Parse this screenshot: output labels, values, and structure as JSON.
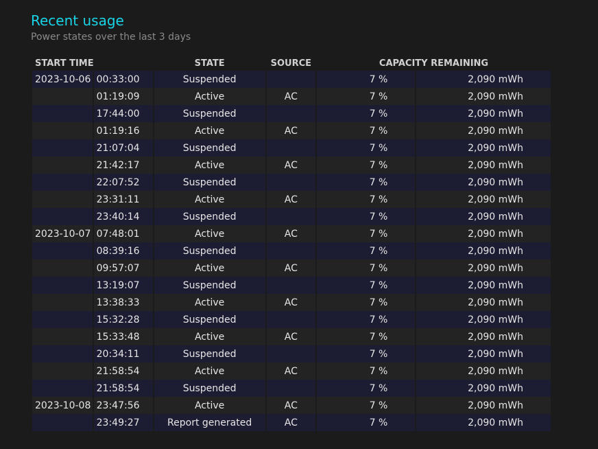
{
  "header": {
    "title": "Recent usage",
    "subtitle": "Power states over the last 3 days"
  },
  "columns": {
    "start_time": "START TIME",
    "state": "STATE",
    "source": "SOURCE",
    "capacity": "CAPACITY REMAINING"
  },
  "rows": [
    {
      "date": "2023-10-06",
      "time": "00:33:00",
      "state": "Suspended",
      "source": "",
      "percent": "7 %",
      "capacity": "2,090 mWh"
    },
    {
      "date": "",
      "time": "01:19:09",
      "state": "Active",
      "source": "AC",
      "percent": "7 %",
      "capacity": "2,090 mWh"
    },
    {
      "date": "",
      "time": "17:44:00",
      "state": "Suspended",
      "source": "",
      "percent": "7 %",
      "capacity": "2,090 mWh"
    },
    {
      "date": "",
      "time": "01:19:16",
      "state": "Active",
      "source": "AC",
      "percent": "7 %",
      "capacity": "2,090 mWh"
    },
    {
      "date": "",
      "time": "21:07:04",
      "state": "Suspended",
      "source": "",
      "percent": "7 %",
      "capacity": "2,090 mWh"
    },
    {
      "date": "",
      "time": "21:42:17",
      "state": "Active",
      "source": "AC",
      "percent": "7 %",
      "capacity": "2,090 mWh"
    },
    {
      "date": "",
      "time": "22:07:52",
      "state": "Suspended",
      "source": "",
      "percent": "7 %",
      "capacity": "2,090 mWh"
    },
    {
      "date": "",
      "time": "23:31:11",
      "state": "Active",
      "source": "AC",
      "percent": "7 %",
      "capacity": "2,090 mWh"
    },
    {
      "date": "",
      "time": "23:40:14",
      "state": "Suspended",
      "source": "",
      "percent": "7 %",
      "capacity": "2,090 mWh"
    },
    {
      "date": "2023-10-07",
      "time": "07:48:01",
      "state": "Active",
      "source": "AC",
      "percent": "7 %",
      "capacity": "2,090 mWh"
    },
    {
      "date": "",
      "time": "08:39:16",
      "state": "Suspended",
      "source": "",
      "percent": "7 %",
      "capacity": "2,090 mWh"
    },
    {
      "date": "",
      "time": "09:57:07",
      "state": "Active",
      "source": "AC",
      "percent": "7 %",
      "capacity": "2,090 mWh"
    },
    {
      "date": "",
      "time": "13:19:07",
      "state": "Suspended",
      "source": "",
      "percent": "7 %",
      "capacity": "2,090 mWh"
    },
    {
      "date": "",
      "time": "13:38:33",
      "state": "Active",
      "source": "AC",
      "percent": "7 %",
      "capacity": "2,090 mWh"
    },
    {
      "date": "",
      "time": "15:32:28",
      "state": "Suspended",
      "source": "",
      "percent": "7 %",
      "capacity": "2,090 mWh"
    },
    {
      "date": "",
      "time": "15:33:48",
      "state": "Active",
      "source": "AC",
      "percent": "7 %",
      "capacity": "2,090 mWh"
    },
    {
      "date": "",
      "time": "20:34:11",
      "state": "Suspended",
      "source": "",
      "percent": "7 %",
      "capacity": "2,090 mWh"
    },
    {
      "date": "",
      "time": "21:58:54",
      "state": "Active",
      "source": "AC",
      "percent": "7 %",
      "capacity": "2,090 mWh"
    },
    {
      "date": "",
      "time": "21:58:54",
      "state": "Suspended",
      "source": "",
      "percent": "7 %",
      "capacity": "2,090 mWh"
    },
    {
      "date": "2023-10-08",
      "time": "23:47:56",
      "state": "Active",
      "source": "AC",
      "percent": "7 %",
      "capacity": "2,090 mWh"
    },
    {
      "date": "",
      "time": "23:49:27",
      "state": "Report generated",
      "source": "AC",
      "percent": "7 %",
      "capacity": "2,090 mWh"
    }
  ]
}
